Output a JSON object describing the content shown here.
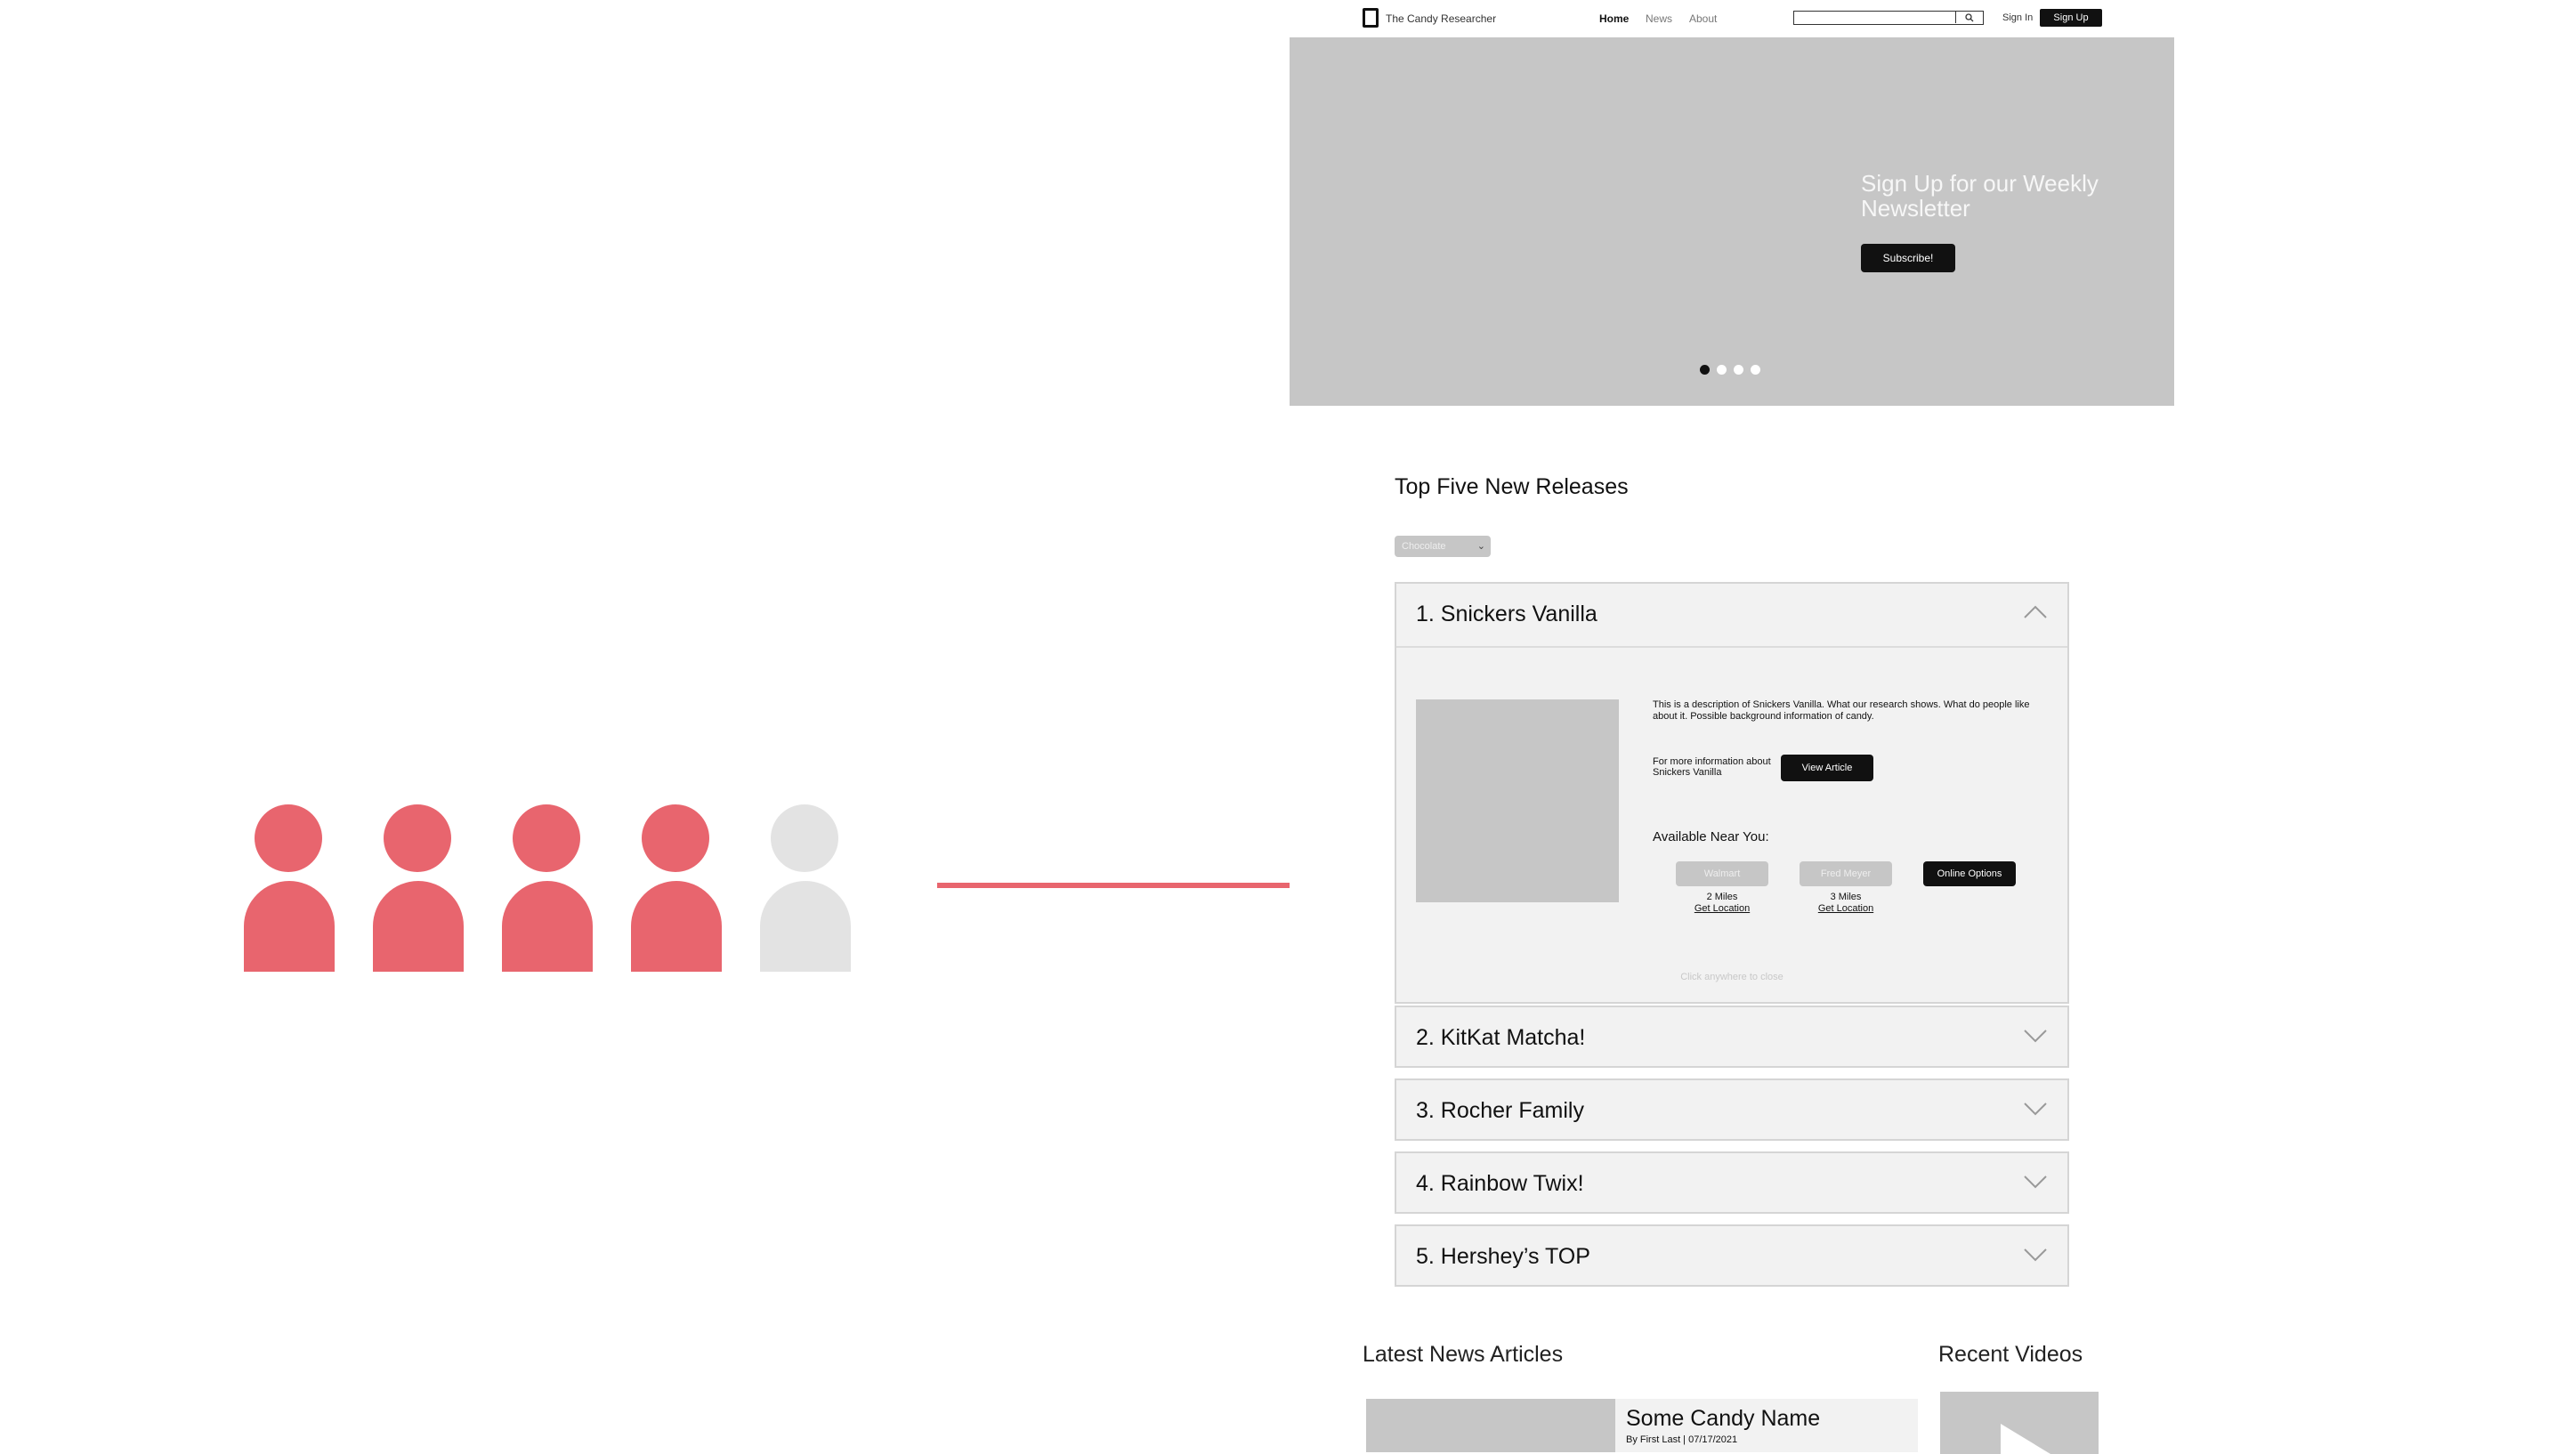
{
  "colors": {
    "accent": "#e8656e",
    "inactive": "#e3e3e3",
    "wire_gray": "#c6c6c6",
    "panel": "#f2f2f2"
  },
  "illustration": {
    "people": [
      {
        "state": "filled"
      },
      {
        "state": "filled"
      },
      {
        "state": "filled"
      },
      {
        "state": "filled"
      },
      {
        "state": "empty"
      }
    ]
  },
  "header": {
    "logo_text": "The Candy Researcher",
    "nav": [
      "Home",
      "News",
      "About"
    ],
    "search_icon": "search-icon",
    "sign_in": "Sign In",
    "sign_up": "Sign Up"
  },
  "hero": {
    "title": "Sign Up for our Weekly Newsletter",
    "button": "Subscribe!",
    "slides_total": 4,
    "active_slide": 1
  },
  "releases": {
    "title": "Top Five New Releases",
    "filter_value": "Chocolate",
    "items": [
      {
        "label": "1. Snickers Vanilla",
        "expanded": true
      },
      {
        "label": "2. KitKat Matcha!",
        "expanded": false
      },
      {
        "label": "3. Rocher Family",
        "expanded": false
      },
      {
        "label": "4. Rainbow Twix!",
        "expanded": false
      },
      {
        "label": "5. Hershey’s TOP",
        "expanded": false
      }
    ],
    "detail": {
      "description": "This is a description of Snickers Vanilla. What our research shows. What do people like about it. Possible background information of candy.",
      "more_info": "For more information about Snickers Vanilla",
      "view_button": "View Article",
      "available": "Available Near You:",
      "stores": [
        {
          "name": "Walmart",
          "distance": "2 Miles",
          "link": "Get Location"
        },
        {
          "name": "Fred Meyer",
          "distance": "3 Miles",
          "link": "Get Location"
        }
      ],
      "online_button": "Online Options",
      "close_hint": "Click anywhere to close"
    }
  },
  "news": {
    "latest_title": "Latest News Articles",
    "recent_title": "Recent Videos",
    "article_title": "Some Candy Name",
    "article_byline": "By First Last | 07/17/2021"
  }
}
